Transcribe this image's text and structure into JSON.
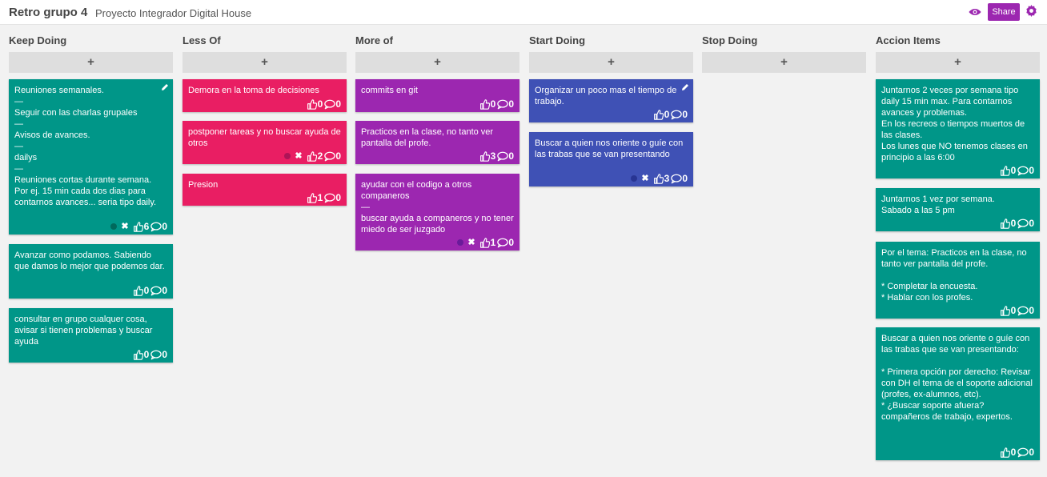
{
  "header": {
    "title": "Retro grupo 4",
    "subtitle": "Proyecto Integrador Digital House",
    "share_label": "Share",
    "icons": {
      "view": "eye-icon",
      "settings": "gear-icon"
    },
    "colors": {
      "accent": "#9c27b0"
    }
  },
  "add_label": "+",
  "colors": {
    "teal": "#009688",
    "pink": "#e91e63",
    "purple": "#9c27b0",
    "indigo": "#3f51b5"
  },
  "columns": [
    {
      "title": "Keep Doing",
      "cards": [
        {
          "text": "Reuniones semanales.\n—\nSeguir con las charlas grupales\n—\nAvisos de avances.\n—\ndailys\n—\nReuniones cortas durante semana. Por ej. 15 min cada dos dias para contarnos avances... seria tipo daily.",
          "likes": "6",
          "comments": "0"
        },
        {
          "text": "Avanzar como podamos. Sabiendo que damos lo mejor que podemos dar.",
          "likes": "0",
          "comments": "0"
        },
        {
          "text": "consultar en grupo cualquer cosa, avisar si tienen problemas y buscar ayuda",
          "likes": "0",
          "comments": "0"
        }
      ]
    },
    {
      "title": "Less Of",
      "cards": [
        {
          "text": "Demora en la toma de decisiones",
          "likes": "0",
          "comments": "0"
        },
        {
          "text": "postponer tareas y no buscar ayuda de otros",
          "likes": "2",
          "comments": "0"
        },
        {
          "text": "Presion",
          "likes": "1",
          "comments": "0"
        }
      ]
    },
    {
      "title": "More of",
      "cards": [
        {
          "text": "commits en git",
          "likes": "0",
          "comments": "0"
        },
        {
          "text": "Practicos en la clase, no tanto ver pantalla del profe.",
          "likes": "3",
          "comments": "0"
        },
        {
          "text": "ayudar con el codigo a otros companeros\n—\nbuscar ayuda a companeros y no tener miedo de ser juzgado",
          "likes": "1",
          "comments": "0"
        }
      ]
    },
    {
      "title": "Start Doing",
      "cards": [
        {
          "text": "Organizar un poco mas el tiempo de trabajo.",
          "likes": "0",
          "comments": "0"
        },
        {
          "text": "Buscar a quien nos oriente o guíe con las trabas que se van presentando",
          "likes": "3",
          "comments": "0"
        }
      ]
    },
    {
      "title": "Stop Doing",
      "cards": []
    },
    {
      "title": "Accion Items",
      "cards": [
        {
          "text": "Juntarnos 2 veces por semana tipo daily 15 min max. Para contarnos avances y problemas.\nEn los recreos o tiempos muertos de las clases.\nLos lunes que NO tenemos clases en principio a las 6:00",
          "likes": "0",
          "comments": "0"
        },
        {
          "text": "Juntarnos 1 vez por semana.\nSabado a las 5 pm",
          "likes": "0",
          "comments": "0"
        },
        {
          "text": "Por el tema: Practicos en la clase, no tanto ver pantalla del profe.\n\n* Completar la encuesta.\n* Hablar con los profes.",
          "likes": "0",
          "comments": "0"
        },
        {
          "text": "Buscar a quien nos oriente o guíe con las trabas que se van presentando:\n\n* Primera opción por derecho: Revisar con DH el tema de el soporte adicional (profes, ex-alumnos, etc).\n* ¿Buscar soporte afuera? compañeros de trabajo, expertos.",
          "likes": "0",
          "comments": "0"
        }
      ]
    }
  ]
}
